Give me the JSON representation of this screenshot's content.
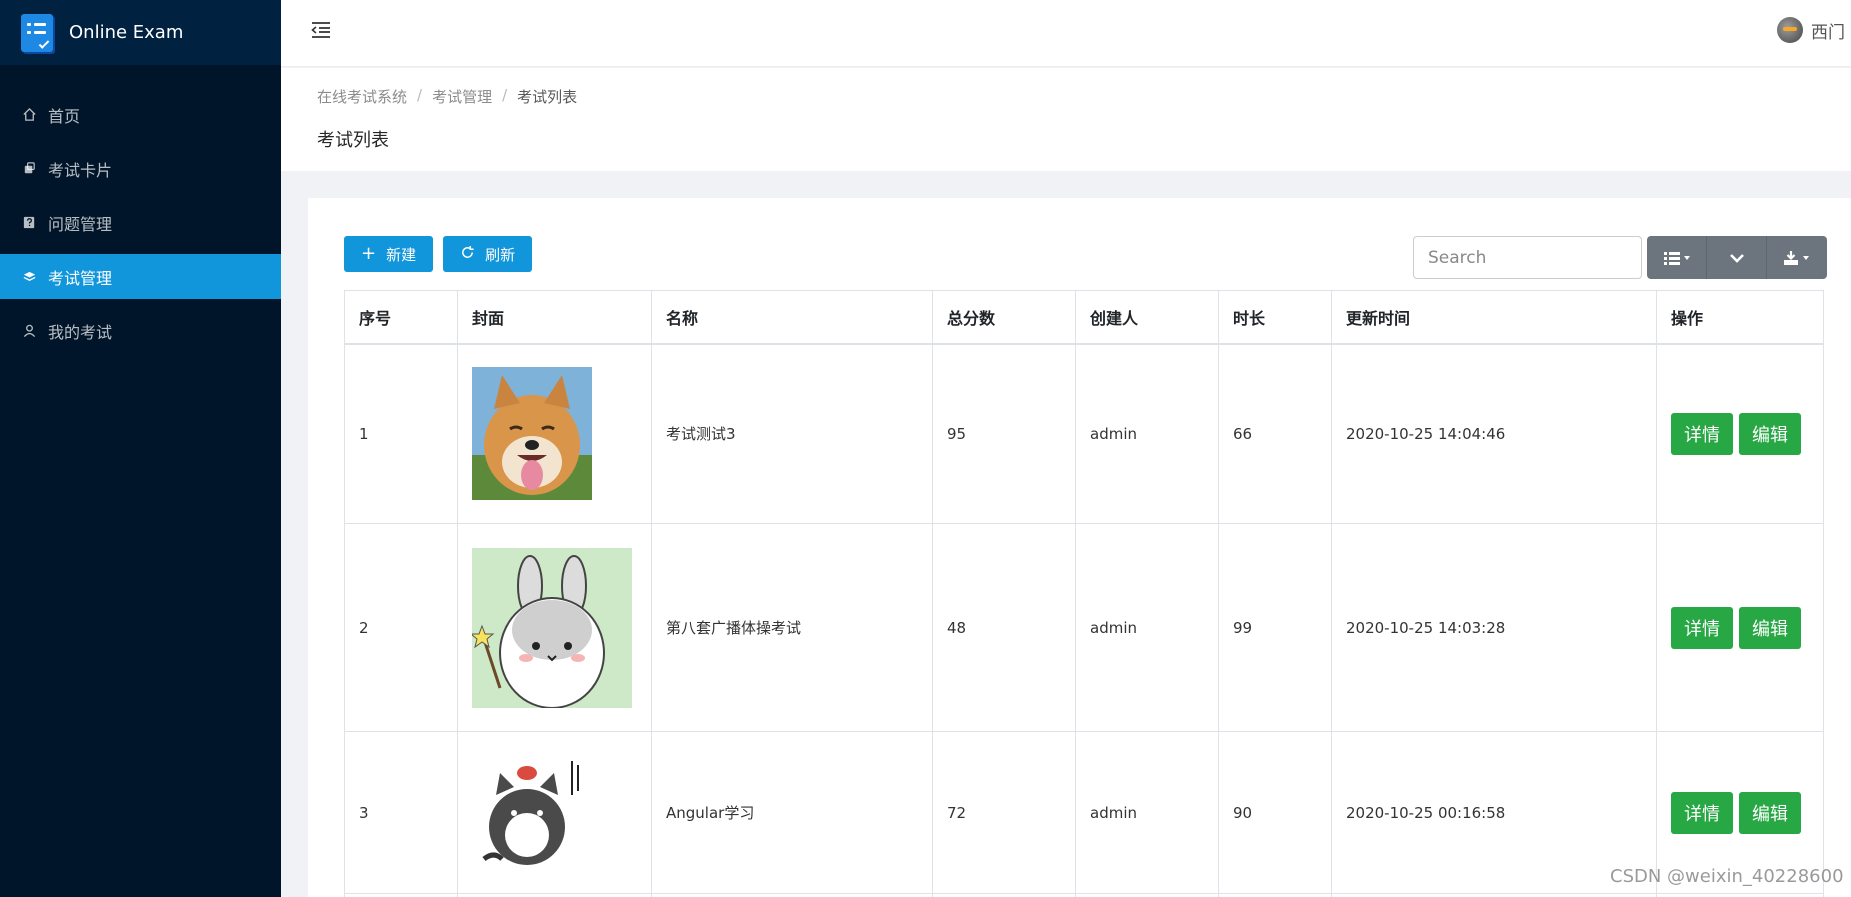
{
  "app": {
    "title": "Online Exam"
  },
  "sidebar": {
    "items": [
      {
        "label": "首页",
        "icon": "home-icon",
        "active": false
      },
      {
        "label": "考试卡片",
        "icon": "cards-icon",
        "active": false
      },
      {
        "label": "问题管理",
        "icon": "question-icon",
        "active": false
      },
      {
        "label": "考试管理",
        "icon": "layers-icon",
        "active": true
      },
      {
        "label": "我的考试",
        "icon": "user-icon",
        "active": false
      }
    ]
  },
  "header": {
    "username": "西门"
  },
  "breadcrumb": [
    "在线考试系统",
    "考试管理",
    "考试列表"
  ],
  "page": {
    "title": "考试列表"
  },
  "toolbar": {
    "new_label": "新建",
    "refresh_label": "刷新"
  },
  "search": {
    "placeholder": "Search",
    "value": ""
  },
  "table": {
    "columns": [
      "序号",
      "封面",
      "名称",
      "总分数",
      "创建人",
      "时长",
      "更新时间",
      "操作"
    ],
    "rows": [
      {
        "index": "1",
        "name": "考试测试3",
        "score": "95",
        "creator": "admin",
        "duration": "66",
        "updated": "2020-10-25 14:04:46",
        "cover": "shiba-dog"
      },
      {
        "index": "2",
        "name": "第八套广播体操考试",
        "score": "48",
        "creator": "admin",
        "duration": "99",
        "updated": "2020-10-25 14:03:28",
        "cover": "cartoon-rabbit"
      },
      {
        "index": "3",
        "name": "Angular学习",
        "score": "72",
        "creator": "admin",
        "duration": "90",
        "updated": "2020-10-25 00:16:58",
        "cover": "cartoon-cat"
      }
    ],
    "actions": {
      "detail_label": "详情",
      "edit_label": "编辑"
    }
  },
  "watermark": "CSDN @weixin_40228600",
  "colors": {
    "sidebar": "#001529",
    "accent": "#1296db",
    "success": "#28a745",
    "grey_button": "#6c757d"
  }
}
